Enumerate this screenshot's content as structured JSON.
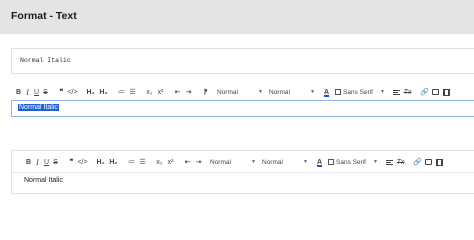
{
  "header": {
    "title": "Format - Text"
  },
  "output": {
    "html_text": "Normal Italic"
  },
  "toolbar": {
    "bold": "B",
    "italic": "I",
    "underline": "U",
    "strike": "S",
    "quote": "❞",
    "code": "</>",
    "h1": "H₁",
    "h2": "H₂",
    "ordered_list": "≔",
    "bullet_list": "☰",
    "subscript": "x₂",
    "superscript": "x²",
    "outdent": "⇤",
    "indent": "⇥",
    "rtl": "⁋",
    "size1": "Normal",
    "size2": "Normal",
    "font_color": "A",
    "font": "Sans Serif",
    "clean": "Tx",
    "link": "🔗",
    "caret": "▼"
  },
  "editor1": {
    "text": "Normal Italic"
  },
  "editor2": {
    "text": "Normal Italic"
  },
  "colors": {
    "selection": "#1f5fd9",
    "focus_border": "#8fb4e8",
    "header_bg": "#e4e4e6"
  }
}
